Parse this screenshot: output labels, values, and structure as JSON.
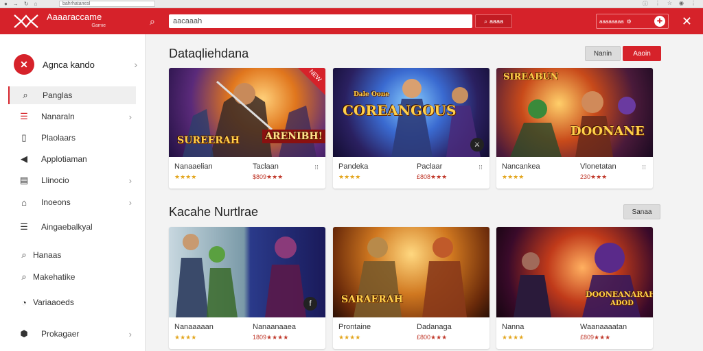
{
  "browser": {
    "url": "bahrhatanesl"
  },
  "header": {
    "brand_name": "Aaaaraccame",
    "brand_tagline": "Gamie",
    "search_placeholder": "aacaaah",
    "search_button": "aaaa",
    "right_label": "aaaaaaaa"
  },
  "sidebar": {
    "profile_name": "Agnca kando",
    "items": [
      {
        "label": "Panglas",
        "icon": "search-icon"
      },
      {
        "label": "Nanaraln",
        "icon": "list-icon"
      },
      {
        "label": "Plaolaars",
        "icon": "document-icon"
      },
      {
        "label": "Applotiaman",
        "icon": "megaphone-icon"
      },
      {
        "label": "Llinocio",
        "icon": "news-icon"
      },
      {
        "label": "Inoeons",
        "icon": "bank-icon"
      },
      {
        "label": "Aingaebalkyal",
        "icon": "list-icon"
      },
      {
        "label": "Hanaas",
        "icon": "search-icon"
      },
      {
        "label": "Makehatike",
        "icon": "magnifier-icon"
      },
      {
        "label": "Variaaoeds",
        "icon": "chat-icon"
      },
      {
        "label": "Prokagaer",
        "icon": "shield-icon"
      }
    ]
  },
  "section1": {
    "title": "Dataqliehdana",
    "btn_grey": "Nanin",
    "btn_red": "Aaoin",
    "cards": [
      {
        "art_title": "SUREERAH",
        "art_badge": "ARENIBH!",
        "ribbon": "NEW",
        "title_a": "Nanaaelian",
        "title_b": "Taclaan",
        "rating_a": "★★★★",
        "rating_b": "$809★★★"
      },
      {
        "art_title": "COREANGOUS",
        "art_badge": "Dale Oone",
        "ribbon": "",
        "title_a": "Pandeka",
        "title_b": "Paclaar",
        "rating_a": "★★★★",
        "rating_b": "£808★★★"
      },
      {
        "art_title": "DOONANE",
        "art_badge": "SIREABUN",
        "ribbon": "",
        "title_a": "Nancankea",
        "title_b": "Vlonetatan",
        "rating_a": "★★★★",
        "rating_b": "230★★★"
      }
    ]
  },
  "section2": {
    "title": "Kacahe Nurtlrae",
    "btn_grey": "Sanaa",
    "cards": [
      {
        "art_title": "",
        "art_badge": "",
        "title_a": "Nanaaaaan",
        "title_b": "Nanaanaaea",
        "rating_a": "★★★★",
        "rating_b": "1809★★★★"
      },
      {
        "art_title": "SARAERAH",
        "art_badge": "",
        "title_a": "Prontaine",
        "title_b": "Dadanaga",
        "rating_a": "★★★★",
        "rating_b": "£800★★★"
      },
      {
        "art_title": "DOONEANARAH",
        "art_badge": "ADOD",
        "title_a": "Nanna",
        "title_b": "Waanaaaatan",
        "rating_a": "★★★★",
        "rating_b": "£809★★★"
      }
    ]
  },
  "colors": {
    "brand_red": "#d6222a",
    "star_gold": "#e3a51c"
  }
}
